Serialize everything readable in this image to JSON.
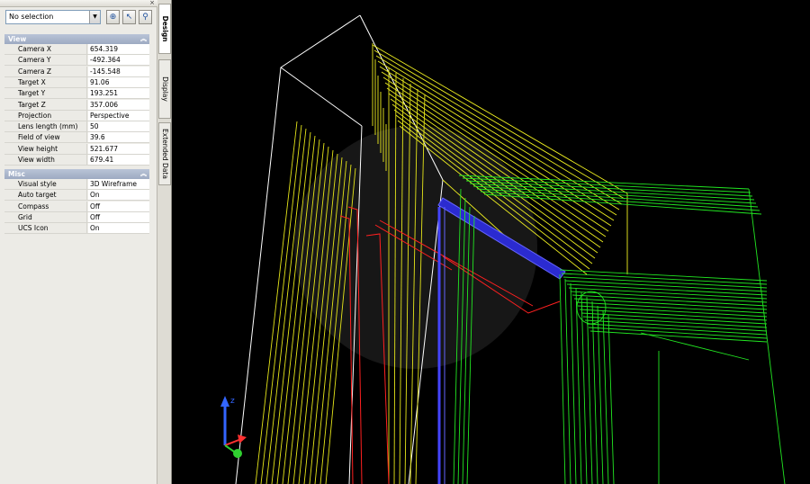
{
  "palette": {
    "selection": "No selection",
    "close_glyph": "×",
    "tool_icons": [
      "toggle-pickadd-icon",
      "select-objects-icon",
      "quick-select-icon"
    ],
    "sections": [
      {
        "title": "View",
        "rows": [
          {
            "name": "Camera X",
            "value": "654.319"
          },
          {
            "name": "Camera Y",
            "value": "-492.364"
          },
          {
            "name": "Camera Z",
            "value": "-145.548"
          },
          {
            "name": "Target X",
            "value": "91.06"
          },
          {
            "name": "Target Y",
            "value": "193.251"
          },
          {
            "name": "Target Z",
            "value": "357.006"
          },
          {
            "name": "Projection",
            "value": "Perspective"
          },
          {
            "name": "Lens length (mm)",
            "value": "50"
          },
          {
            "name": "Field of view",
            "value": "39.6"
          },
          {
            "name": "View height",
            "value": "521.677"
          },
          {
            "name": "View width",
            "value": "679.41"
          }
        ]
      },
      {
        "title": "Misc",
        "rows": [
          {
            "name": "Visual style",
            "value": "3D Wireframe"
          },
          {
            "name": "Auto target",
            "value": "On"
          },
          {
            "name": "Compass",
            "value": "Off"
          },
          {
            "name": "Grid",
            "value": "Off"
          },
          {
            "name": "UCS Icon",
            "value": "On"
          }
        ]
      }
    ],
    "tabs": [
      "Design",
      "Display",
      "Extended Data"
    ]
  },
  "viewport": {
    "visual_style": "3D Wireframe",
    "colors": {
      "background": "#000000",
      "box": "#ffffff",
      "frame": "#f0f020",
      "frame_inner": "#e6e61a",
      "red": "#ff2020",
      "blue": "#3333ff",
      "green": "#22e622",
      "ucs_z": "#3366ff",
      "ucs_x": "#ff3030",
      "ucs_y": "#30d030"
    },
    "ucs_label": "z"
  }
}
